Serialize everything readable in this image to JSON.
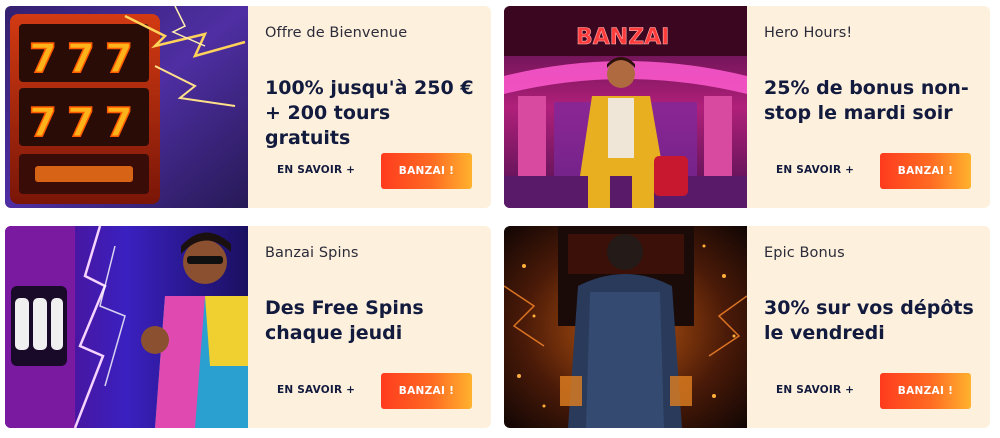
{
  "cards": [
    {
      "subtitle": "Offre de Bienvenue",
      "title": "100% jusqu'à 250 € + 200 tours gratuits",
      "more_label": "EN SAVOIR +",
      "cta_label": "BANZAI !"
    },
    {
      "subtitle": "Hero Hours!",
      "title": "25% de bonus non-stop le mardi soir",
      "more_label": "EN SAVOIR +",
      "cta_label": "BANZAI !",
      "image_sign_text": "BANZAI"
    },
    {
      "subtitle": "Banzai Spins",
      "title": "Des Free Spins chaque jeudi",
      "more_label": "EN SAVOIR +",
      "cta_label": "BANZAI !"
    },
    {
      "subtitle": "Epic Bonus",
      "title": "30% sur vos dépôts le vendredi",
      "more_label": "EN SAVOIR +",
      "cta_label": "BANZAI !"
    }
  ],
  "colors": {
    "card_background": "#fdf1dd",
    "title_text": "#121a3e",
    "cta_gradient_start": "#ff3b1e",
    "cta_gradient_end": "#ffb22e"
  }
}
